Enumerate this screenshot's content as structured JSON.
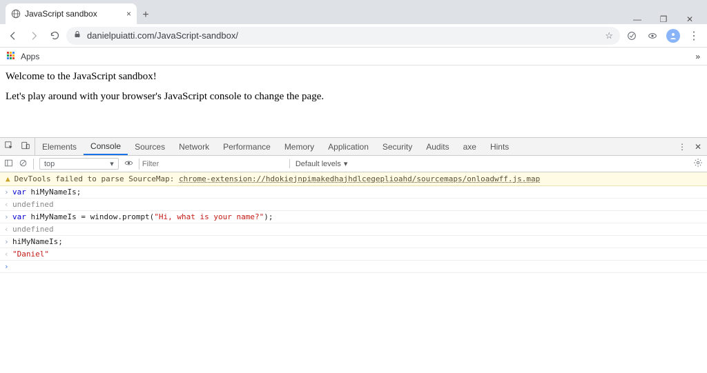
{
  "browser": {
    "tab_title": "JavaScript sandbox",
    "url": "danielpuiatti.com/JavaScript-sandbox/",
    "apps_label": "Apps"
  },
  "page": {
    "line1": "Welcome to the JavaScript sandbox!",
    "line2": "Let's play around with your browser's JavaScript console to change the page."
  },
  "devtools": {
    "tabs": [
      "Elements",
      "Console",
      "Sources",
      "Network",
      "Performance",
      "Memory",
      "Application",
      "Security",
      "Audits",
      "axe",
      "Hints"
    ],
    "active_tab": "Console",
    "context": "top",
    "filter_placeholder": "Filter",
    "levels_label": "Default levels",
    "warning": {
      "prefix": "DevTools failed to parse SourceMap: ",
      "link": "chrome-extension://hdokiejnpimakedhajhdlcegeplioahd/sourcemaps/onloadwff.js.map"
    },
    "lines": {
      "l1_kw": "var",
      "l1_rest": " hiMyNameIs;",
      "l2": "undefined",
      "l3_kw": "var",
      "l3_mid": " hiMyNameIs = window.prompt(",
      "l3_str": "\"Hi, what is your name?\"",
      "l3_end": ");",
      "l4": "undefined",
      "l5": "hiMyNameIs;",
      "l6": "\"Daniel\""
    }
  }
}
